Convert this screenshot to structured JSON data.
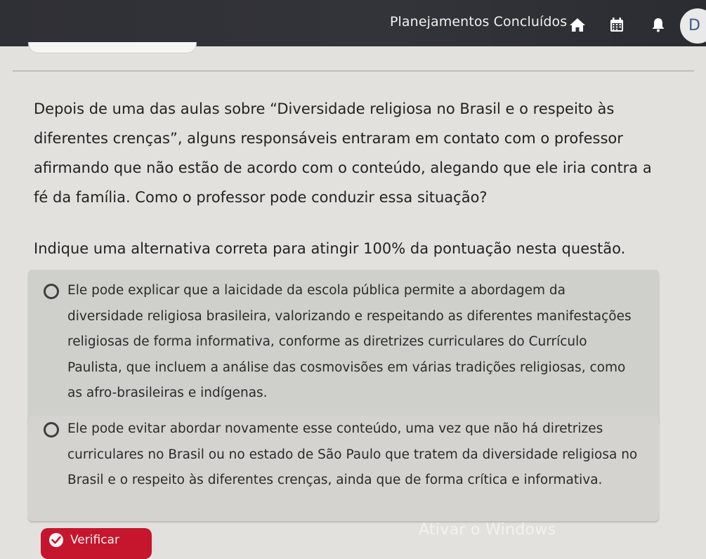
{
  "topbar": {
    "title": "Planejamentos Concluídos",
    "icons": [
      "home-icon",
      "calendar-icon",
      "bell-icon"
    ],
    "avatar_initial": "D"
  },
  "question": {
    "text": "Depois de uma das aulas sobre “Diversidade religiosa no Brasil e o respeito às diferentes crenças”, alguns responsáveis entraram em contato com o professor afirmando que não estão de acordo com o conteúdo, alegando que ele iria contra a fé da família. Como o professor pode conduzir essa situação?",
    "instruction": "Indique uma alternativa correta para atingir 100% da pontuação nesta questão."
  },
  "options": [
    {
      "text": "Ele pode explicar que a laicidade da escola pública permite a abordagem da diversidade religiosa brasileira, valorizando e respeitando as diferentes manifestações religiosas de forma informativa, conforme as diretrizes curriculares do Currículo Paulista, que incluem a análise das cosmovisões em várias tradições religiosas, como as afro-brasileiras e indígenas."
    },
    {
      "text": "Ele pode evitar abordar novamente esse conteúdo, uma vez que não há diretrizes curriculares no Brasil ou no estado de São Paulo que tratem da diversidade religiosa no Brasil e o respeito às diferentes crenças, ainda que de forma crítica e informativa."
    }
  ],
  "verify_button": {
    "label": "Verificar"
  },
  "watermark": "Ativar o Windows",
  "colors": {
    "topbar": "#2f3035",
    "background": "#e2e1dd",
    "option_background": "#cfcfcb",
    "button_red": "#c5162e",
    "avatar_text": "#3c5a86"
  }
}
